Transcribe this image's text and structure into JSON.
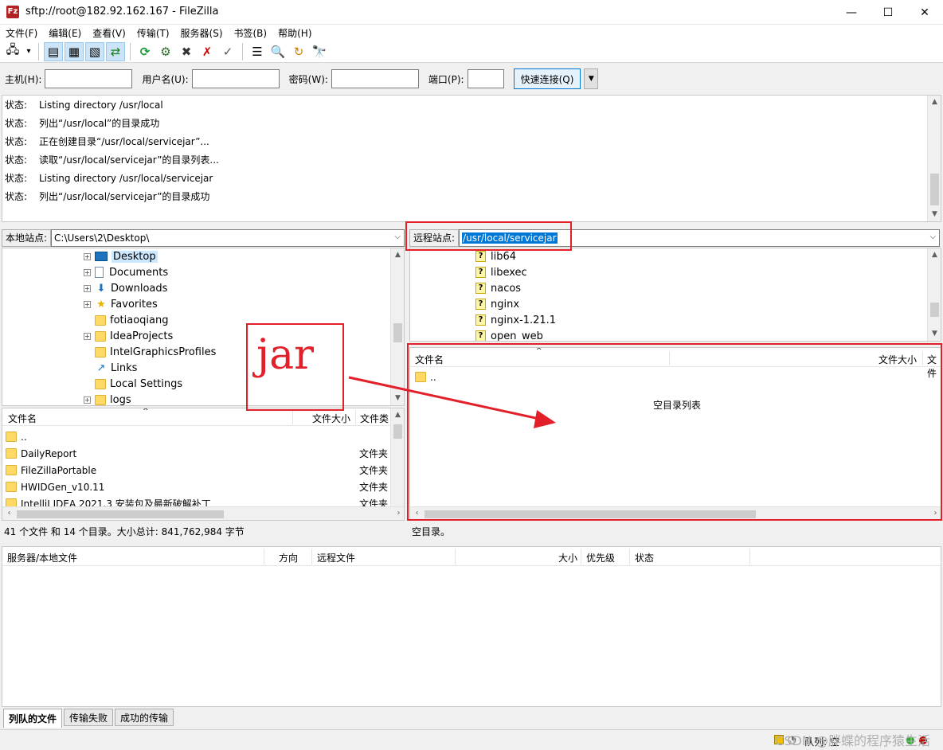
{
  "window": {
    "title": "sftp://root@182.92.162.167 - FileZilla",
    "app_icon": "Fz",
    "minimize": "—",
    "maximize": "☐",
    "close": "✕"
  },
  "menu": [
    "文件(F)",
    "编辑(E)",
    "查看(V)",
    "传输(T)",
    "服务器(S)",
    "书签(B)",
    "帮助(H)"
  ],
  "toolbar_icons": [
    {
      "name": "site-manager-icon",
      "glyph": "🖧"
    },
    {
      "name": "dropdown-arrow-icon",
      "glyph": "▾"
    },
    {
      "name": "toggle-log-icon",
      "glyph": "▤"
    },
    {
      "name": "toggle-local-tree-icon",
      "glyph": "▦"
    },
    {
      "name": "toggle-remote-tree-icon",
      "glyph": "▧"
    },
    {
      "name": "toggle-queue-icon",
      "glyph": "⇄"
    },
    {
      "name": "refresh-icon",
      "glyph": "⟳"
    },
    {
      "name": "process-queue-icon",
      "glyph": "⚙"
    },
    {
      "name": "cancel-icon",
      "glyph": "✖"
    },
    {
      "name": "disconnect-icon",
      "glyph": "✗"
    },
    {
      "name": "reconnect-icon",
      "glyph": "✓"
    },
    {
      "name": "directory-compare-icon",
      "glyph": "☰"
    },
    {
      "name": "filter-icon",
      "glyph": "🔍"
    },
    {
      "name": "sync-browse-icon",
      "glyph": "↻"
    },
    {
      "name": "search-files-icon",
      "glyph": "🔭"
    }
  ],
  "quickconnect": {
    "host_label": "主机(H):",
    "user_label": "用户名(U):",
    "pass_label": "密码(W):",
    "port_label": "端口(P):",
    "connect_button": "快速连接(Q)",
    "dropdown": "▼"
  },
  "log": [
    {
      "k": "状态:",
      "v": "Listing directory /usr/local"
    },
    {
      "k": "状态:",
      "v": "列出“/usr/local”的目录成功"
    },
    {
      "k": "状态:",
      "v": "正在创建目录“/usr/local/servicejar”..."
    },
    {
      "k": "状态:",
      "v": "读取“/usr/local/servicejar”的目录列表..."
    },
    {
      "k": "状态:",
      "v": "Listing directory /usr/local/servicejar"
    },
    {
      "k": "状态:",
      "v": "列出“/usr/local/servicejar”的目录成功"
    }
  ],
  "local": {
    "label": "本地站点:",
    "path": "C:\\Users\\2\\Desktop\\",
    "tree": [
      {
        "label": "Desktop",
        "icon": "desktop",
        "expander": true,
        "selected": true
      },
      {
        "label": "Documents",
        "icon": "doc",
        "expander": true
      },
      {
        "label": "Downloads",
        "icon": "download",
        "expander": true
      },
      {
        "label": "Favorites",
        "icon": "star",
        "expander": true
      },
      {
        "label": "fotiaoqiang",
        "icon": "folder",
        "expander": false
      },
      {
        "label": "IdeaProjects",
        "icon": "folder",
        "expander": true
      },
      {
        "label": "IntelGraphicsProfiles",
        "icon": "folder",
        "expander": false
      },
      {
        "label": "Links",
        "icon": "link",
        "expander": false
      },
      {
        "label": "Local Settings",
        "icon": "folder",
        "expander": false
      },
      {
        "label": "logs",
        "icon": "folder",
        "expander": true
      }
    ],
    "columns": {
      "name": "文件名",
      "size": "文件大小",
      "type": "文件类"
    },
    "files": [
      {
        "name": "..",
        "type": ""
      },
      {
        "name": "DailyReport",
        "type": "文件夹"
      },
      {
        "name": "FileZillaPortable",
        "type": "文件夹"
      },
      {
        "name": "HWIDGen_v10.11",
        "type": "文件夹"
      },
      {
        "name": "IntelliJ IDEA 2021.3 安装包及最新破解补丁",
        "type": "文件夹"
      }
    ],
    "status": "41 个文件 和 14 个目录。大小总计: 841,762,984 字节"
  },
  "remote": {
    "label": "远程站点:",
    "path": "/usr/local/servicejar",
    "tree": [
      "lib64",
      "libexec",
      "nacos",
      "nginx",
      "nginx-1.21.1",
      "open_web"
    ],
    "columns": {
      "name": "文件名",
      "size": "文件大小",
      "type": "文件"
    },
    "files": [
      {
        "name": ".."
      }
    ],
    "empty_text": "空目录列表",
    "status": "空目录。"
  },
  "queue": {
    "columns": [
      "服务器/本地文件",
      "方向",
      "远程文件",
      "大小",
      "优先级",
      "状态"
    ],
    "tabs": [
      "列队的文件",
      "传输失败",
      "成功的传输"
    ],
    "status": "队列: 空"
  },
  "annotation": {
    "text": "jar",
    "color": "#e3202a"
  },
  "watermark": "CSDN @胖蝶的程序猿生活",
  "colors": {
    "accent": "#0078d7",
    "selection": "#cce8ff",
    "annotation": "#e3202a"
  }
}
